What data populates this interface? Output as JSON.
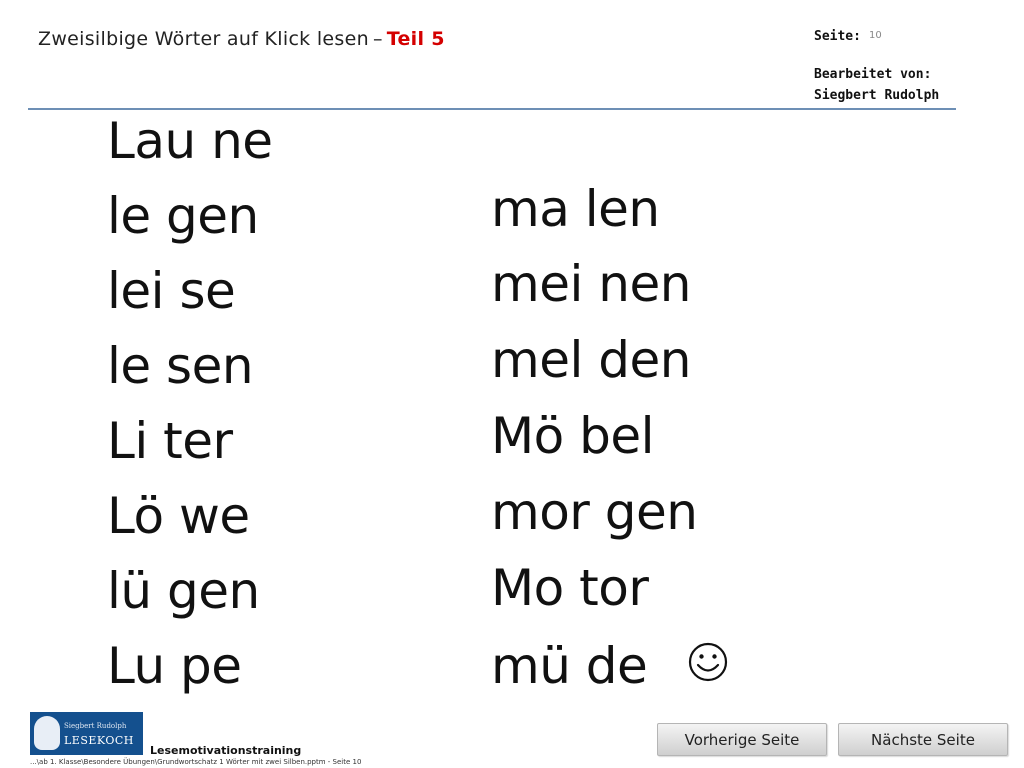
{
  "header": {
    "title_main": "Zweisilbige Wörter auf Klick lesen",
    "title_dash": "–",
    "title_part": "Teil 5",
    "page_label": "Seite:",
    "page_number": "10",
    "editor_label": "Bearbeitet von:",
    "editor_name": "Siegbert Rudolph",
    "accent_color": "#d40000",
    "rule_color": "#6d8fb5"
  },
  "words": {
    "left": [
      "Lau ne",
      "le gen",
      "lei se",
      "le sen",
      "Li ter",
      "Lö we",
      "lü gen",
      "Lu pe"
    ],
    "right": [
      "ma len",
      "mei nen",
      "mel den",
      "Mö bel",
      "mor gen",
      "Mo tor",
      "mü de"
    ]
  },
  "smiley_icon": "smiley-face-icon",
  "footer": {
    "logo_small": "Siegbert Rudolph",
    "logo_big": "LESEKOCH",
    "label": "Lesemotivationstraining",
    "path": "...\\ab 1. Klasse\\Besondere Übungen\\Grundwortschatz 1 Wörter mit zwei Silben.pptm - Seite 10"
  },
  "nav": {
    "prev_label": "Vorherige Seite",
    "next_label": "Nächste Seite"
  }
}
